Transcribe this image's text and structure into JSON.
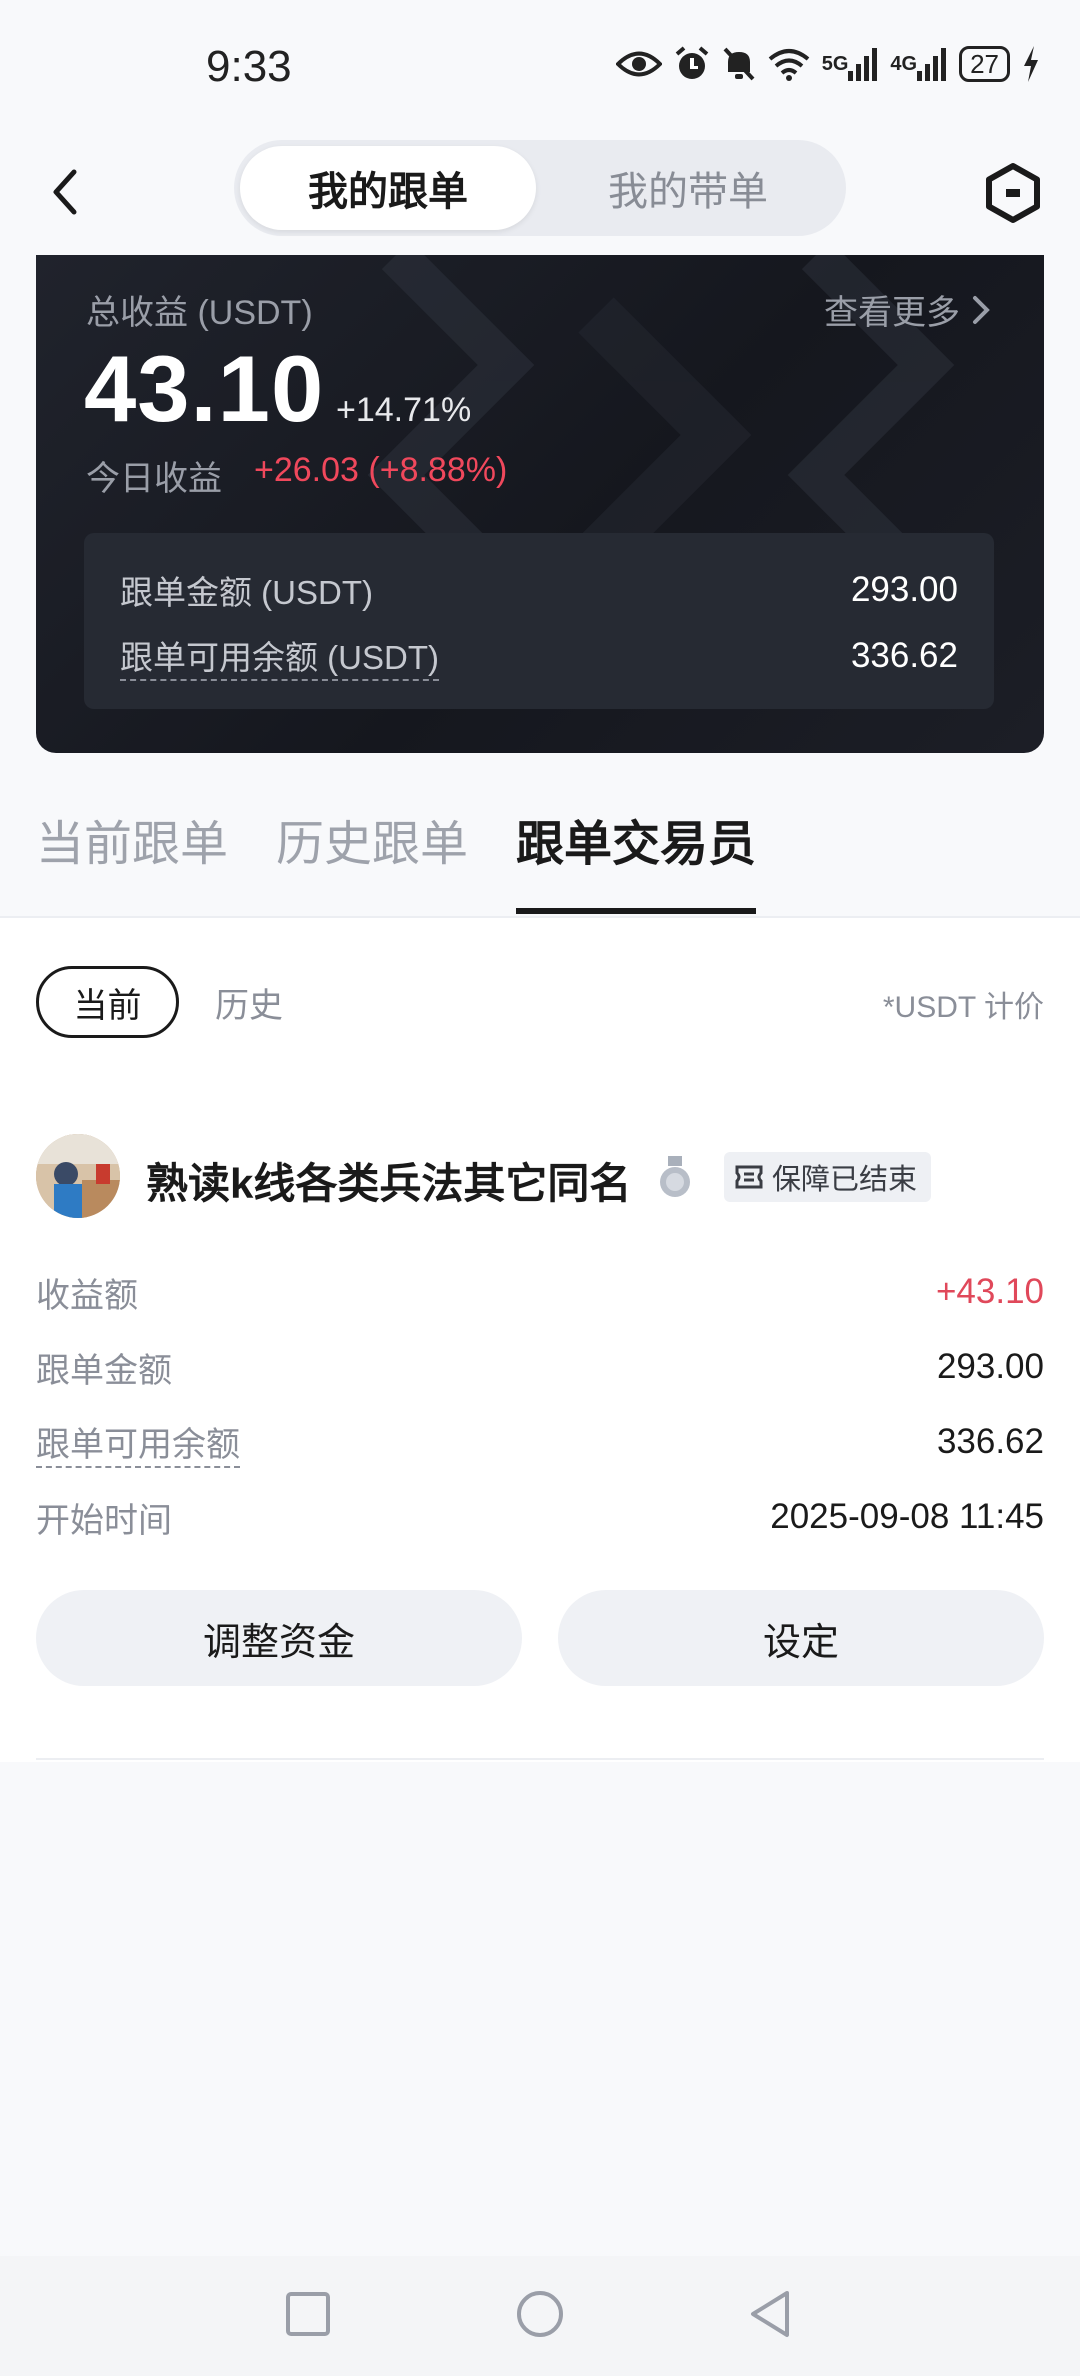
{
  "status_bar": {
    "time": "9:33",
    "net1": "5G",
    "net2": "4G",
    "battery": "27"
  },
  "header": {
    "tab_active": "我的跟单",
    "tab_inactive": "我的带单"
  },
  "summary": {
    "total_label": "总收益 (USDT)",
    "more_label": "查看更多",
    "total_value": "43.10",
    "total_pct": "+14.71%",
    "today_label": "今日收益",
    "today_value": "+26.03 (+8.88%)",
    "amount_label": "跟单金额 (USDT)",
    "amount_value": "293.00",
    "available_label": "跟单可用余额 (USDT)",
    "available_value": "336.62"
  },
  "main_tabs": [
    "当前跟单",
    "历史跟单",
    "跟单交易员"
  ],
  "sub_tabs": {
    "active": "当前",
    "inactive": "历史",
    "price_note": "*USDT 计价"
  },
  "trader": {
    "name": "熟读k线各类兵法其它同名",
    "badge": "保障已结束",
    "rows": [
      {
        "label": "收益额",
        "value": "+43.10"
      },
      {
        "label": "跟单金额",
        "value": "293.00"
      },
      {
        "label": "跟单可用余额",
        "value": "336.62"
      },
      {
        "label": "开始时间",
        "value": "2025-09-08 11:45"
      }
    ],
    "btn_adjust": "调整资金",
    "btn_settings": "设定"
  },
  "colors": {
    "profit_red": "#e0485a",
    "card_bg": "#1b1d24"
  },
  "icons": [
    "eye-icon",
    "alarm-icon",
    "mute-icon",
    "wifi-icon",
    "signal-icon",
    "battery-icon",
    "charging-icon",
    "back-icon",
    "hexagon-settings-icon",
    "chevron-right-icon",
    "medal-icon",
    "ticket-icon",
    "square-nav-icon",
    "circle-nav-icon",
    "triangle-nav-icon"
  ]
}
